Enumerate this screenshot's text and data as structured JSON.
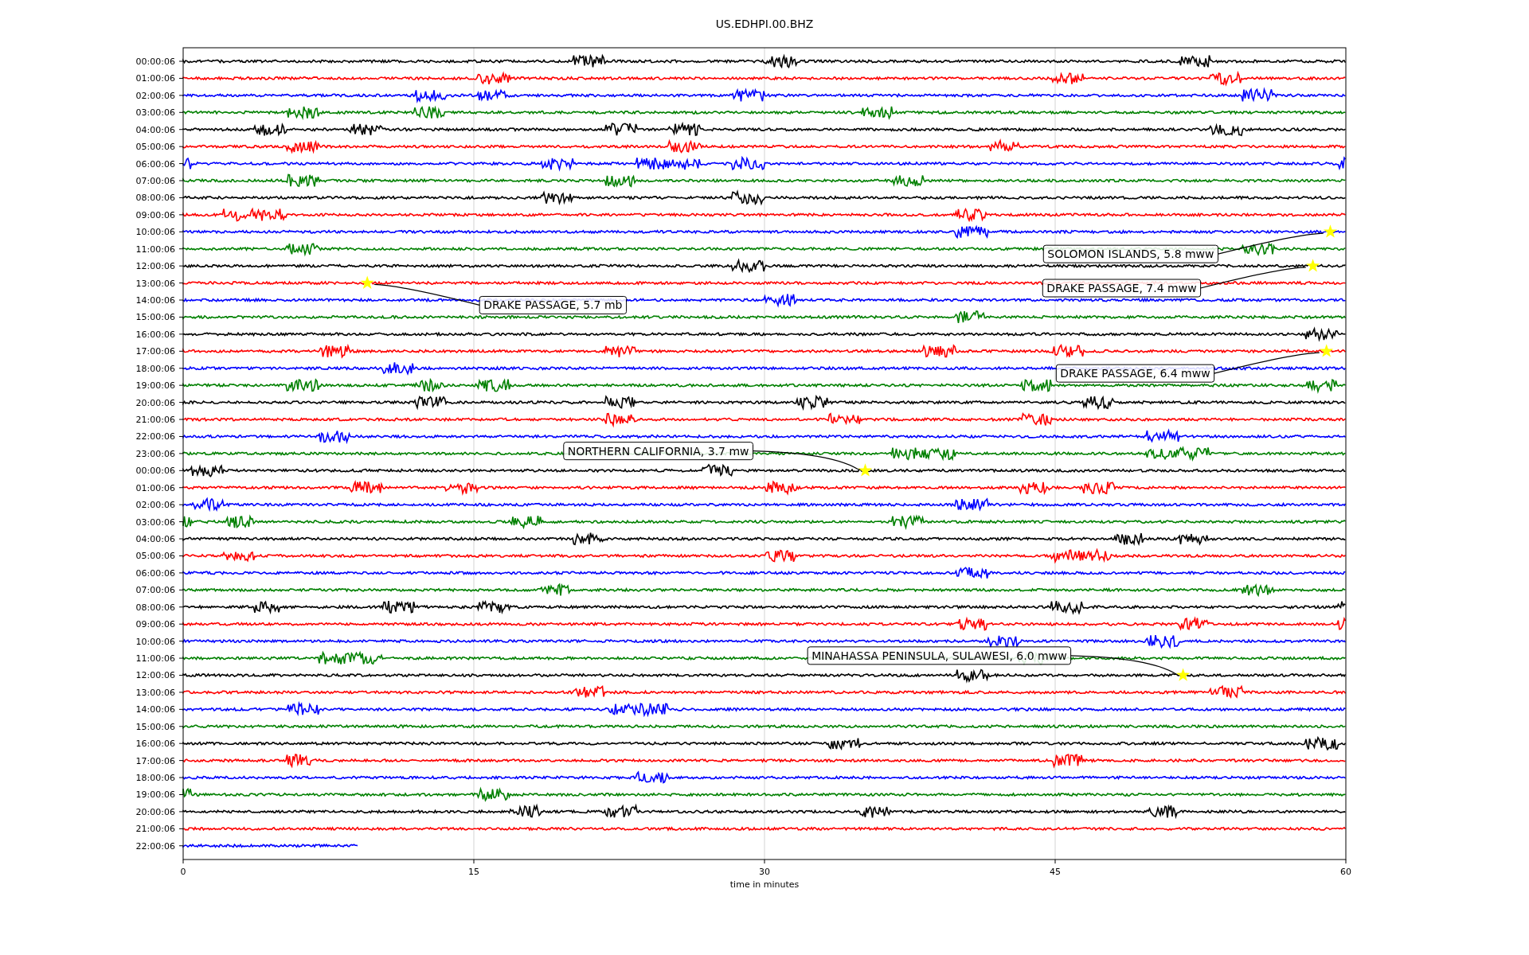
{
  "figure": {
    "title": "US.EDHPI.00.BHZ",
    "row_labels": [
      "00:00:06",
      "01:00:06",
      "02:00:06",
      "03:00:06",
      "04:00:06",
      "05:00:06",
      "06:00:06",
      "07:00:06",
      "08:00:06",
      "09:00:06",
      "10:00:06",
      "11:00:06",
      "12:00:06",
      "13:00:06",
      "14:00:06",
      "15:00:06",
      "16:00:06",
      "17:00:06",
      "18:00:06",
      "19:00:06",
      "20:00:06",
      "21:00:06",
      "22:00:06",
      "23:00:06",
      "00:00:06",
      "01:00:06",
      "02:00:06",
      "03:00:06",
      "04:00:06",
      "05:00:06",
      "06:00:06",
      "07:00:06",
      "08:00:06",
      "09:00:06",
      "10:00:06",
      "11:00:06",
      "12:00:06",
      "13:00:06",
      "14:00:06",
      "15:00:06",
      "16:00:06",
      "17:00:06",
      "18:00:06",
      "19:00:06",
      "20:00:06",
      "21:00:06",
      "22:00:06"
    ],
    "x_tick_labels": [
      "0",
      "15",
      "30",
      "45",
      "60"
    ],
    "xlabel": "time in minutes",
    "events": [
      {
        "text": "SOLOMON ISLANDS, 5.8 mww"
      },
      {
        "text": "DRAKE PASSAGE, 7.4 mww"
      },
      {
        "text": "DRAKE PASSAGE, 5.7 mb"
      },
      {
        "text": "DRAKE PASSAGE, 6.4 mww"
      },
      {
        "text": "NORTHERN CALIFORNIA, 3.7 mw"
      },
      {
        "text": "MINAHASSA PENINSULA, SULAWESI, 6.0 mww"
      }
    ]
  }
}
